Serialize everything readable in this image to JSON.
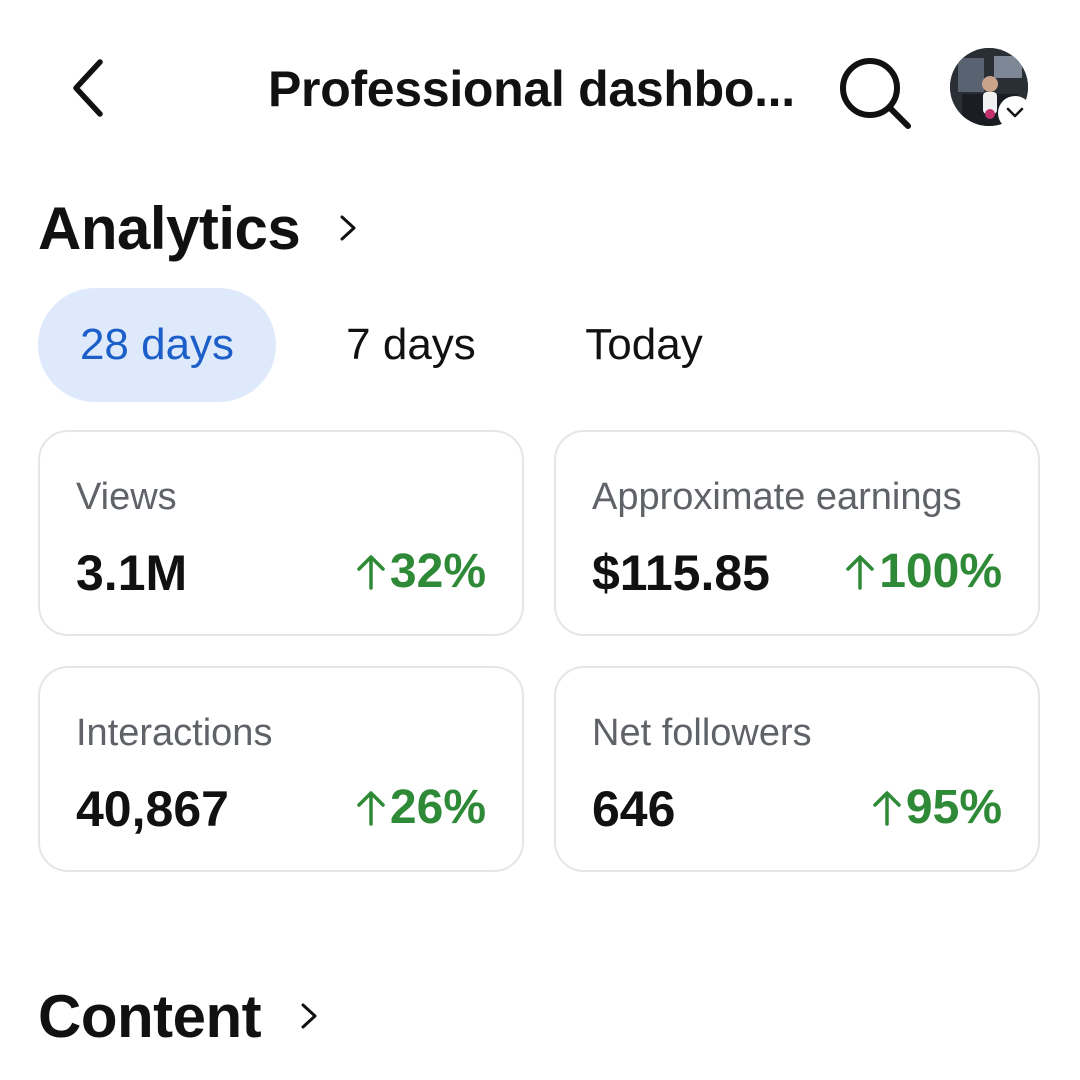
{
  "header": {
    "title": "Professional dashbo...",
    "back_icon": "back-arrow-icon",
    "search_icon": "search-icon",
    "avatar_chevron_icon": "chevron-down-icon"
  },
  "analytics": {
    "title": "Analytics",
    "tabs": [
      {
        "label": "28 days",
        "active": true
      },
      {
        "label": "7 days",
        "active": false
      },
      {
        "label": "Today",
        "active": false
      }
    ],
    "cards": [
      {
        "label": "Views",
        "value": "3.1M",
        "change": "32%",
        "trend": "up"
      },
      {
        "label": "Approximate earnings",
        "value": "$115.85",
        "change": "100%",
        "trend": "up"
      },
      {
        "label": "Interactions",
        "value": "40,867",
        "change": "26%",
        "trend": "up"
      },
      {
        "label": "Net followers",
        "value": "646",
        "change": "95%",
        "trend": "up"
      }
    ]
  },
  "content": {
    "title": "Content"
  },
  "colors": {
    "accent_blue": "#1c5fc9",
    "active_tab_bg": "#deeafb",
    "positive_green": "#2e8a36",
    "muted_text": "#5f6368",
    "card_border": "#e6e6e6"
  }
}
